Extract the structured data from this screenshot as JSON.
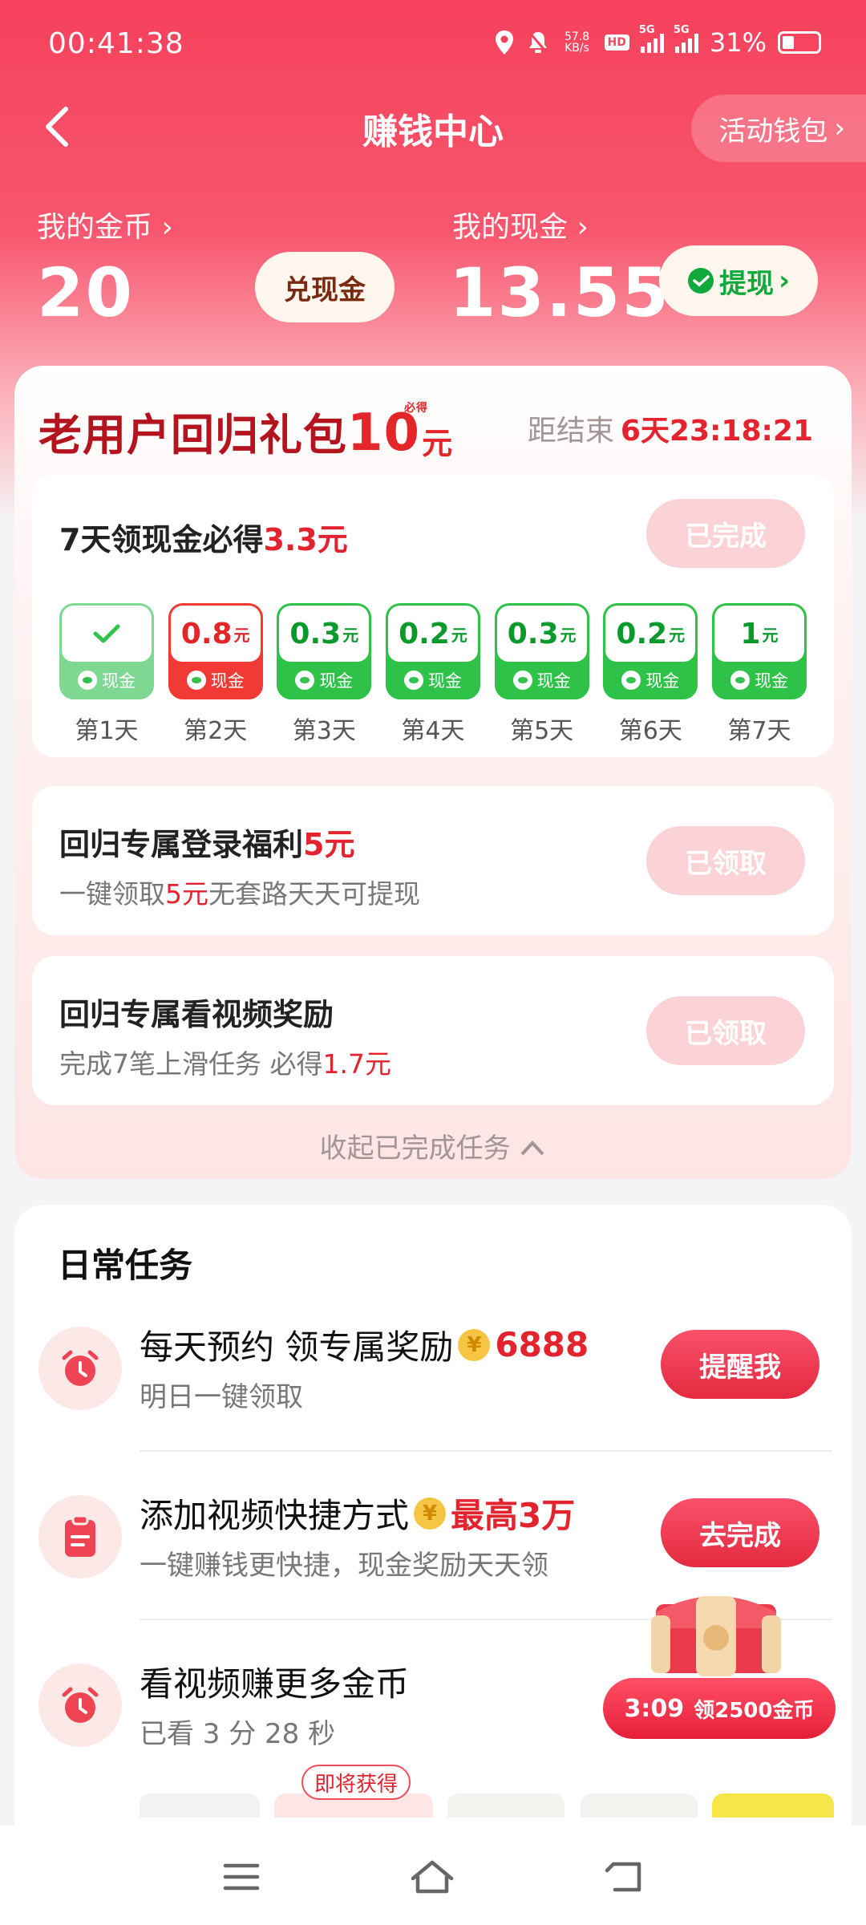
{
  "status_bar": {
    "time": "00:41:38",
    "net_speed_value": "57.8",
    "net_speed_unit": "KB/s",
    "hd_label": "HD",
    "signal_1": "5G",
    "signal_2": "5G",
    "battery": "31%"
  },
  "nav": {
    "title": "赚钱中心",
    "wallet": "活动钱包"
  },
  "balances": {
    "coins_label": "我的金币",
    "coins_value": "20",
    "exchange_button": "兑现金",
    "cash_label": "我的现金",
    "cash_value": "13.55",
    "withdraw_button": "提现"
  },
  "return_pack": {
    "title_prefix": "老用户回归礼包",
    "title_amount": "10",
    "title_unit": "元",
    "title_tag": "必得",
    "countdown_label": "距结束",
    "countdown_value": "6天23:18:21",
    "task1": {
      "title_prefix": "7天领现金必得",
      "title_highlight": "3.3元",
      "button": "已完成",
      "days": [
        {
          "amount": "",
          "unit": "",
          "cash_label": "现金",
          "day_label": "第1天",
          "state": "done"
        },
        {
          "amount": "0.8",
          "unit": "元",
          "cash_label": "现金",
          "day_label": "第2天",
          "state": "red"
        },
        {
          "amount": "0.3",
          "unit": "元",
          "cash_label": "现金",
          "day_label": "第3天",
          "state": "normal"
        },
        {
          "amount": "0.2",
          "unit": "元",
          "cash_label": "现金",
          "day_label": "第4天",
          "state": "normal"
        },
        {
          "amount": "0.3",
          "unit": "元",
          "cash_label": "现金",
          "day_label": "第5天",
          "state": "normal"
        },
        {
          "amount": "0.2",
          "unit": "元",
          "cash_label": "现金",
          "day_label": "第6天",
          "state": "normal"
        },
        {
          "amount": "1",
          "unit": "元",
          "cash_label": "现金",
          "day_label": "第7天",
          "state": "normal"
        }
      ]
    },
    "task2": {
      "title_prefix": "回归专属登录福利",
      "title_highlight": "5元",
      "sub_prefix": "一键领取",
      "sub_highlight": "5元",
      "sub_suffix": "无套路天天可提现",
      "button": "已领取"
    },
    "task3": {
      "title": "回归专属看视频奖励",
      "sub_prefix": "完成7笔上滑任务 必得",
      "sub_highlight": "1.7元",
      "button": "已领取"
    },
    "collapse": "收起已完成任务"
  },
  "daily": {
    "title": "日常任务",
    "rows": [
      {
        "title": "每天预约 领专属奖励",
        "coin_glyph": "¥",
        "highlight": "6888",
        "sub": "明日一键领取",
        "button": "提醒我",
        "icon": "alarm-clock-icon"
      },
      {
        "title": "添加视频快捷方式",
        "coin_glyph": "¥",
        "highlight": "最高3万",
        "sub": "一键赚钱更快捷，现金奖励天天领",
        "button": "去完成",
        "icon": "clipboard-icon"
      },
      {
        "title": "看视频赚更多金币",
        "coin_glyph": "",
        "highlight": "",
        "sub": "已看 3 分 28 秒",
        "button": "",
        "icon": "alarm-clock-icon"
      }
    ],
    "soon_tag": "即将获得"
  },
  "chest": {
    "timer": "3:09",
    "text": "领2500金币"
  },
  "colors": {
    "hero_top": "#f6415c",
    "accent_red": "#e3242f",
    "green": "#2ec248"
  }
}
